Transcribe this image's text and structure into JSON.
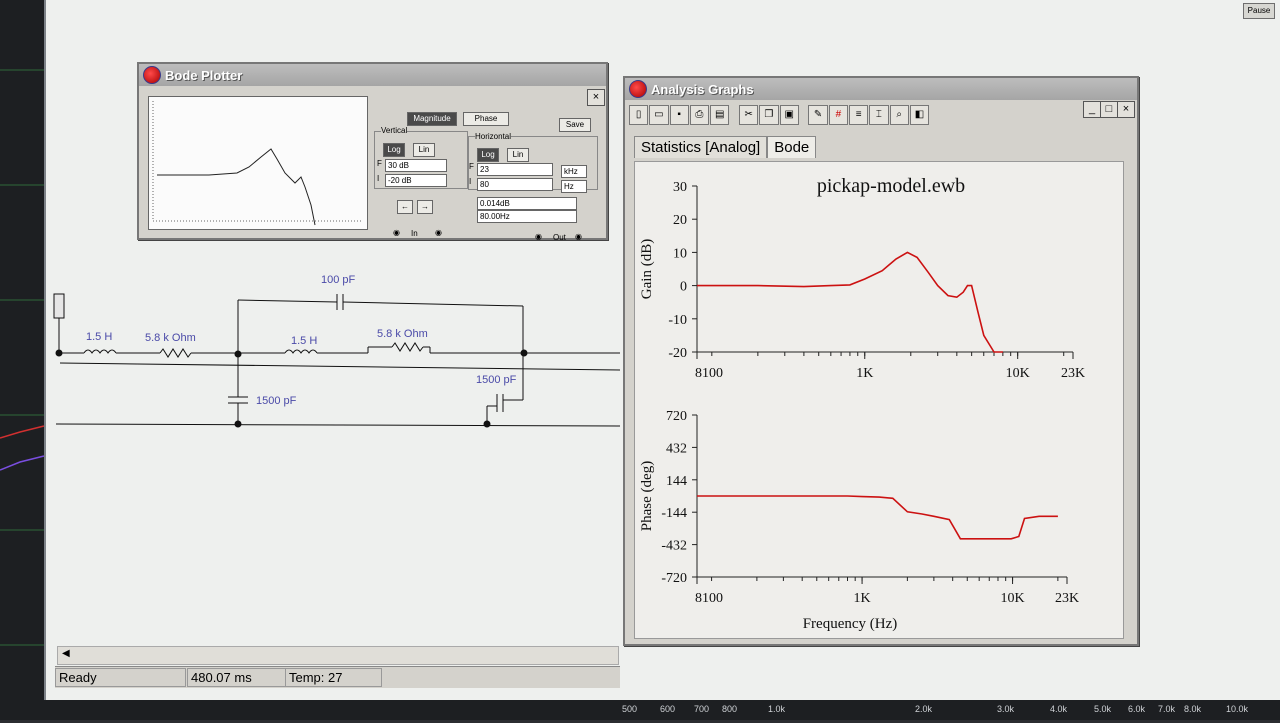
{
  "toolbar_pause": "Pause",
  "bode_plotter": {
    "title": "Bode Plotter",
    "close": "×",
    "magnitude_label": "Magnitude",
    "phase_label": "Phase",
    "save_label": "Save",
    "vertical_label": "Vertical",
    "horizontal_label": "Horizontal",
    "log_label": "Log",
    "lin_label": "Lin",
    "f_label": "F",
    "i_label": "I",
    "vertical_final": "30 dB",
    "vertical_initial": "-20 dB",
    "horizontal_final": "23",
    "horizontal_initial": "80",
    "horizontal_final_unit": "kHz",
    "horizontal_initial_unit": "Hz",
    "readout_db": "0.014dB",
    "readout_hz": "80.00Hz",
    "in_label": "In",
    "out_label": "Out",
    "left_arrow": "←",
    "right_arrow": "→"
  },
  "circuit": {
    "l1": "1.5 H",
    "r1": "5.8 k Ohm",
    "l2": "1.5 H",
    "r2": "5.8 k Ohm",
    "c_top": "100 pF",
    "c_left": "1500 pF",
    "c_right": "1500 pF"
  },
  "analysis_graphs": {
    "title": "Analysis Graphs",
    "tabs": [
      "Statistics [Analog]",
      "Bode"
    ],
    "minimize": "_",
    "maximize": "□",
    "close": "×"
  },
  "status": {
    "ready": "Ready",
    "time": "480.07 ms",
    "temp": "Temp:  27"
  },
  "bottom_axis_ticks": [
    "500",
    "600",
    "700",
    "800",
    "1.0k",
    "2.0k",
    "3.0k",
    "4.0k",
    "5.0k",
    "6.0k",
    "7.0k",
    "8.0k",
    "10.0k"
  ],
  "chart_data": [
    {
      "type": "line",
      "title": "pickap-model.ewb",
      "xlabel": "",
      "ylabel": "Gain (dB)",
      "xscale": "log",
      "xlim": [
        80,
        23000
      ],
      "ylim": [
        -20,
        30
      ],
      "x_ticks": [
        "8100",
        "1K",
        "10K",
        "23K"
      ],
      "y_ticks": [
        "30",
        "20",
        "10",
        "0",
        "-10",
        "-20"
      ],
      "color": "#cc1111",
      "series": [
        {
          "x": [
            80,
            200,
            400,
            600,
            800,
            1000,
            1300,
            1600,
            1900,
            2200,
            2600,
            3000,
            3500,
            4000,
            4400,
            4700,
            5000,
            5500,
            6000,
            7000,
            8000
          ],
          "y": [
            0,
            0,
            -0.3,
            0,
            0.2,
            2,
            4.5,
            8,
            10,
            8.5,
            4,
            0,
            -3,
            -3.5,
            -2,
            0,
            0,
            -8,
            -15,
            -20,
            -20
          ]
        }
      ]
    },
    {
      "type": "line",
      "title": "",
      "xlabel": "Frequency (Hz)",
      "ylabel": "Phase (deg)",
      "xscale": "log",
      "xlim": [
        80,
        23000
      ],
      "ylim": [
        -720,
        720
      ],
      "x_ticks": [
        "8100",
        "1K",
        "10K",
        "23K"
      ],
      "y_ticks": [
        "720",
        "432",
        "144",
        "-144",
        "-432",
        "-720"
      ],
      "color": "#cc1111",
      "series": [
        {
          "x": [
            80,
            200,
            500,
            800,
            1000,
            1300,
            1600,
            2000,
            2500,
            3000,
            3800,
            4500,
            5000,
            6000,
            7000,
            8000,
            9000,
            9800,
            11000,
            12000,
            15000,
            20000
          ],
          "y": [
            0,
            0,
            0,
            0,
            -5,
            -10,
            -20,
            -140,
            -160,
            -180,
            -210,
            -380,
            -380,
            -380,
            -380,
            -380,
            -380,
            -380,
            -360,
            -200,
            -180,
            -180
          ]
        }
      ]
    }
  ]
}
